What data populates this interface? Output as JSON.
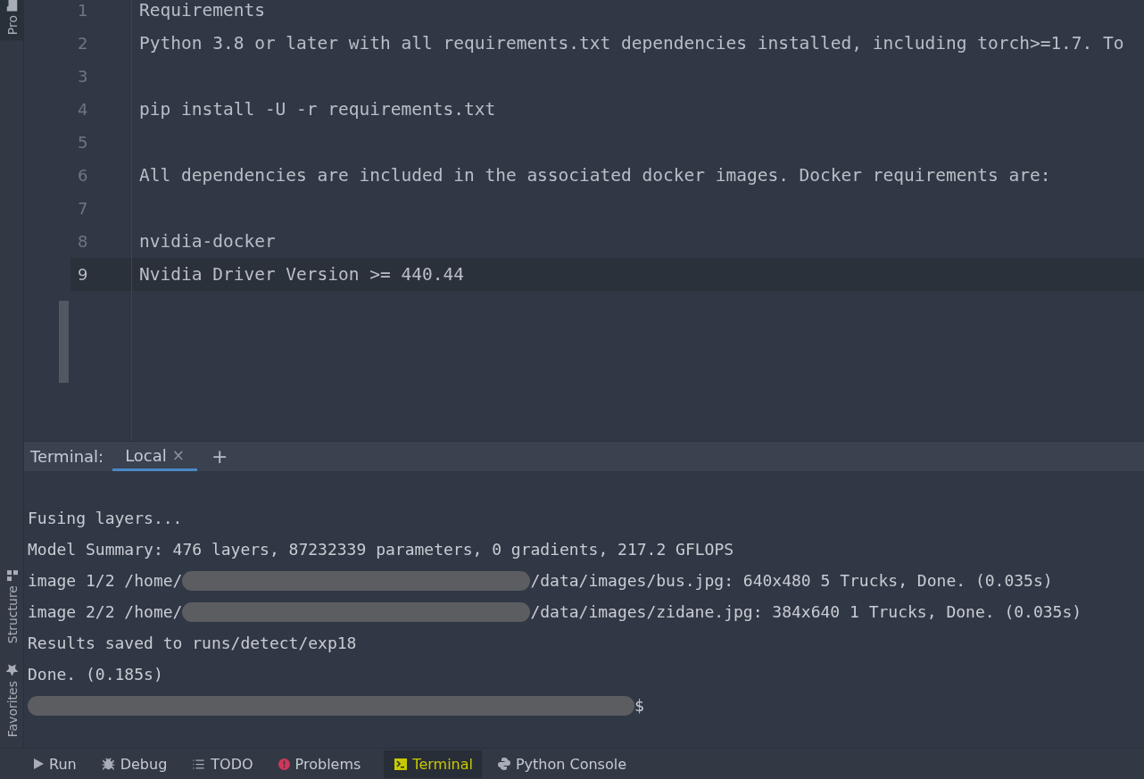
{
  "side_strip": {
    "top_tab": "Pro",
    "bottom_tabs": [
      {
        "label": "Structure",
        "kind": "structure"
      },
      {
        "label": "Favorites",
        "kind": "favorites"
      }
    ]
  },
  "editor": {
    "lines": [
      {
        "number": "1",
        "text": "Requirements",
        "current": false
      },
      {
        "number": "2",
        "text": "Python 3.8 or later with all requirements.txt dependencies installed, including torch>=1.7. To",
        "current": false
      },
      {
        "number": "3",
        "current": false
      },
      {
        "number": "4",
        "text": "pip install -U -r requirements.txt",
        "current": false
      },
      {
        "number": "5",
        "current": false
      },
      {
        "number": "6",
        "text": "All dependencies are included in the associated docker images. Docker requirements are:",
        "current": false
      },
      {
        "number": "7",
        "current": false
      },
      {
        "number": "8",
        "text": "nvidia-docker",
        "current": false
      },
      {
        "number": "9",
        "text": "Nvidia Driver Version >= 440.44",
        "current": true
      }
    ]
  },
  "terminal": {
    "label": "Terminal:",
    "tabs": [
      {
        "label": "Local",
        "close": "×",
        "selected": true
      }
    ],
    "add": "+",
    "lines": [
      [
        {
          "kind": "text",
          "text": "Fusing layers..."
        }
      ],
      [
        {
          "kind": "text",
          "text": "Model Summary: 476 layers, 87232339 parameters, 0 gradients, 217.2 GFLOPS"
        }
      ],
      [
        {
          "kind": "text",
          "text": "image 1/2 /home/"
        },
        {
          "kind": "redaction"
        },
        {
          "kind": "text",
          "text": "/data/images/bus.jpg: 640x480 5 Trucks, Done. (0.035s)"
        }
      ],
      [
        {
          "kind": "text",
          "text": "image 2/2 /home/"
        },
        {
          "kind": "redaction"
        },
        {
          "kind": "text",
          "text": "/data/images/zidane.jpg: 384x640 1 Trucks, Done. (0.035s)"
        }
      ],
      [
        {
          "kind": "text",
          "text": "Results saved to runs/detect/exp18"
        }
      ],
      [
        {
          "kind": "text",
          "text": "Done. (0.185s)"
        }
      ],
      [
        {
          "kind": "redaction"
        },
        {
          "kind": "text",
          "text": "$"
        }
      ]
    ]
  },
  "tool_bar": [
    {
      "label": "Run",
      "kind": "run",
      "selected": false
    },
    {
      "label": "Debug",
      "kind": "debug",
      "selected": false
    },
    {
      "label": "TODO",
      "kind": "todo",
      "selected": false
    },
    {
      "label": "Problems",
      "kind": "problems",
      "selected": false
    },
    {
      "label": "Terminal",
      "kind": "terminal",
      "selected": true
    },
    {
      "label": "Python Console",
      "kind": "python",
      "selected": false
    }
  ]
}
